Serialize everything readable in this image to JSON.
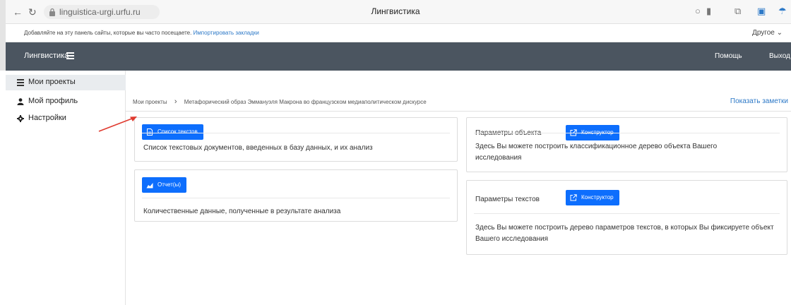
{
  "browser": {
    "url": "linguistica-urgi.urfu.ru",
    "tab_title": "Лингвистика",
    "bookmarks_prompt": "Добавляйте на эту панель сайты, которые вы часто посещаете.",
    "import_bookmarks": "Импортировать закладки",
    "other_bookmarks": "Другое ⌄"
  },
  "navbar": {
    "brand": "Лингвистика",
    "help": "Помощь",
    "logout": "Выход"
  },
  "sidebar": {
    "items": [
      {
        "label": "Мои проекты",
        "icon": "list-icon",
        "active": true
      },
      {
        "label": "Мой профиль",
        "icon": "user-icon",
        "active": false
      },
      {
        "label": "Настройки",
        "icon": "gear-icon",
        "active": false
      }
    ]
  },
  "breadcrumb": {
    "root": "Мои проекты",
    "current": "Метафорический образ Эммануэля Макрона во французском медиаполитическом дискурсе"
  },
  "notes_link": "Показать заметки",
  "cards": {
    "texts": {
      "button": "Список текстов",
      "description": "Список текстовых документов, введенных в базу данных, и их анализ"
    },
    "reports": {
      "button": "Отчет(ы)",
      "description": "Количественные данные, полученные в результате анализа"
    },
    "object_params": {
      "title": "Параметры объекта",
      "button": "Конструктор",
      "description": "Здесь Вы можете построить классификационное дерево объекта Вашего исследования"
    },
    "text_params": {
      "title": "Параметры текстов",
      "button": "Конструктор",
      "description": "Здесь Вы можете построить дерево параметров текстов, в которых Вы фиксируете объект Вашего исследования"
    }
  },
  "colors": {
    "primary": "#0d6efd",
    "navbar": "#4b5560",
    "link": "#2d79c7",
    "annotation_arrow": "#e03a2f"
  }
}
